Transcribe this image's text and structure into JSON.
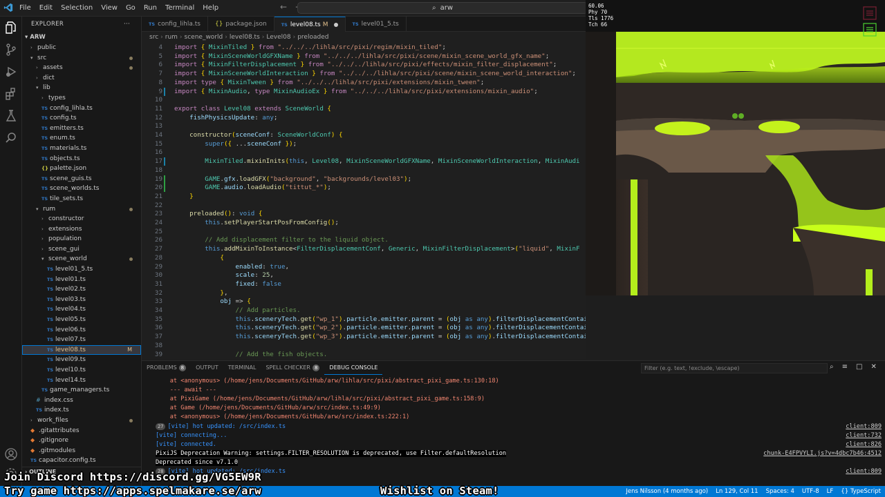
{
  "menu": [
    "File",
    "Edit",
    "Selection",
    "View",
    "Go",
    "Run",
    "Terminal",
    "Help"
  ],
  "command_center": "arw",
  "sidebar": {
    "title": "EXPLORER",
    "root": "ARW",
    "items": [
      {
        "label": "public",
        "type": "folder",
        "indent": 1,
        "open": false
      },
      {
        "label": "src",
        "type": "folder",
        "indent": 1,
        "open": true,
        "dot": true
      },
      {
        "label": "assets",
        "type": "folder",
        "indent": 2,
        "open": false,
        "dot": true
      },
      {
        "label": "dict",
        "type": "folder",
        "indent": 2,
        "open": false
      },
      {
        "label": "lib",
        "type": "folder",
        "indent": 2,
        "open": true
      },
      {
        "label": "types",
        "type": "folder",
        "indent": 3,
        "open": false
      },
      {
        "label": "config_lihla.ts",
        "type": "ts",
        "indent": 3
      },
      {
        "label": "config.ts",
        "type": "ts",
        "indent": 3
      },
      {
        "label": "emitters.ts",
        "type": "ts",
        "indent": 3
      },
      {
        "label": "enum.ts",
        "type": "ts",
        "indent": 3
      },
      {
        "label": "materials.ts",
        "type": "ts",
        "indent": 3
      },
      {
        "label": "objects.ts",
        "type": "ts",
        "indent": 3
      },
      {
        "label": "palette.json",
        "type": "json",
        "indent": 3
      },
      {
        "label": "scene_guis.ts",
        "type": "ts",
        "indent": 3
      },
      {
        "label": "scene_worlds.ts",
        "type": "ts",
        "indent": 3
      },
      {
        "label": "tile_sets.ts",
        "type": "ts",
        "indent": 3
      },
      {
        "label": "rum",
        "type": "folder",
        "indent": 2,
        "open": true,
        "dot": true
      },
      {
        "label": "constructor",
        "type": "folder",
        "indent": 3,
        "open": false
      },
      {
        "label": "extensions",
        "type": "folder",
        "indent": 3,
        "open": false
      },
      {
        "label": "population",
        "type": "folder",
        "indent": 3,
        "open": false
      },
      {
        "label": "scene_gui",
        "type": "folder",
        "indent": 3,
        "open": false
      },
      {
        "label": "scene_world",
        "type": "folder",
        "indent": 3,
        "open": true,
        "dot": true
      },
      {
        "label": "level01_5.ts",
        "type": "ts",
        "indent": 4
      },
      {
        "label": "level01.ts",
        "type": "ts",
        "indent": 4
      },
      {
        "label": "level02.ts",
        "type": "ts",
        "indent": 4
      },
      {
        "label": "level03.ts",
        "type": "ts",
        "indent": 4
      },
      {
        "label": "level04.ts",
        "type": "ts",
        "indent": 4
      },
      {
        "label": "level05.ts",
        "type": "ts",
        "indent": 4
      },
      {
        "label": "level06.ts",
        "type": "ts",
        "indent": 4
      },
      {
        "label": "level07.ts",
        "type": "ts",
        "indent": 4
      },
      {
        "label": "level08.ts",
        "type": "ts",
        "indent": 4,
        "active": true,
        "modified": "M"
      },
      {
        "label": "level09.ts",
        "type": "ts",
        "indent": 4
      },
      {
        "label": "level10.ts",
        "type": "ts",
        "indent": 4
      },
      {
        "label": "level14.ts",
        "type": "ts",
        "indent": 4
      },
      {
        "label": "game_managers.ts",
        "type": "ts",
        "indent": 3
      },
      {
        "label": "index.css",
        "type": "css",
        "indent": 2
      },
      {
        "label": "index.ts",
        "type": "ts",
        "indent": 2
      },
      {
        "label": "work_files",
        "type": "folder",
        "indent": 1,
        "open": false,
        "dot": true
      },
      {
        "label": ".gitattributes",
        "type": "git",
        "indent": 1
      },
      {
        "label": ".gitignore",
        "type": "git",
        "indent": 1
      },
      {
        "label": ".gitmodules",
        "type": "git",
        "indent": 1
      },
      {
        "label": "capacitor.config.ts",
        "type": "ts",
        "indent": 1
      }
    ],
    "outline": "OUTLINE"
  },
  "tabs": [
    {
      "label": "config_lihla.ts",
      "icon": "TS"
    },
    {
      "label": "package.json",
      "icon": "{}"
    },
    {
      "label": "level08.ts",
      "icon": "TS",
      "active": true,
      "mark": "M"
    },
    {
      "label": "level01_5.ts",
      "icon": "TS"
    }
  ],
  "breadcrumb": [
    "src",
    "rum",
    "scene_world",
    "level08.ts",
    "Level08",
    "preloaded"
  ],
  "editor": {
    "lines": [
      {
        "n": "4",
        "t": "import { MixinTiled } from \"../../../lihla/src/pixi/regim/mixin_tiled\";"
      },
      {
        "n": "5",
        "t": "import { MixinSceneWorldGFXName } from \"../../../lihla/src/pixi/scene/mixin_scene_world_gfx_name\";"
      },
      {
        "n": "6",
        "t": "import { MixinFilterDisplacement } from \"../../../lihla/src/pixi/effects/mixin_filter_displacement\";"
      },
      {
        "n": "7",
        "t": "import { MixinSceneWorldInteraction } from \"../../../lihla/src/pixi/scene/mixin_scene_world_interaction\";"
      },
      {
        "n": "8",
        "t": "import type { MixinTween } from \"../../../lihla/src/pixi/extensions/mixin_tween\";"
      },
      {
        "n": "9",
        "t": "import { MixinAudio, type MixinAudioEx } from \"../../../lihla/src/pixi/extensions/mixin_audio\";"
      },
      {
        "n": "10",
        "t": ""
      },
      {
        "n": "11",
        "t": "export class Level08 extends SceneWorld {"
      },
      {
        "n": "12",
        "t": "    fishPhysicsUpdate: any;"
      },
      {
        "n": "13",
        "t": ""
      },
      {
        "n": "14",
        "t": "    constructor(sceneConf: SceneWorldConf) {"
      },
      {
        "n": "15",
        "t": "        super({ ...sceneConf });"
      },
      {
        "n": "16",
        "t": ""
      },
      {
        "n": "17",
        "t": "        MixinTiled.mixinInits(this, Level08, MixinSceneWorldGFXName, MixinSceneWorldInteraction, MixinAudi"
      },
      {
        "n": "18",
        "t": ""
      },
      {
        "n": "19",
        "t": "        GAME.gfx.loadGFX(\"background\", \"backgrounds/level03\");"
      },
      {
        "n": "20",
        "t": "        GAME.audio.loadAudio(\"tittut_*\");"
      },
      {
        "n": "21",
        "t": "    }"
      },
      {
        "n": "22",
        "t": ""
      },
      {
        "n": "23",
        "t": "    preloaded(): void {"
      },
      {
        "n": "24",
        "t": "        this.setPlayerStartPosFromConfig();"
      },
      {
        "n": "25",
        "t": ""
      },
      {
        "n": "26",
        "t": "        // Add displacement filter to the liquid object."
      },
      {
        "n": "27",
        "t": "        this.addMixinToInstance<FilterDisplacementConf, Generic, MixinFilterDisplacement>(\"liquid\", MixinF"
      },
      {
        "n": "28",
        "t": "            {"
      },
      {
        "n": "29",
        "t": "                enabled: true,"
      },
      {
        "n": "30",
        "t": "                scale: 25,"
      },
      {
        "n": "31",
        "t": "                fixed: false"
      },
      {
        "n": "32",
        "t": "            },"
      },
      {
        "n": "33",
        "t": "            obj => {"
      },
      {
        "n": "34",
        "t": "                // Add particles."
      },
      {
        "n": "35",
        "t": "                this.sceneryTech.get(\"wp_1\").particle.emitter.parent = (obj as any).filterDisplacementContainer;"
      },
      {
        "n": "36",
        "t": "                this.sceneryTech.get(\"wp_2\").particle.emitter.parent = (obj as any).filterDisplacementContainer;"
      },
      {
        "n": "37",
        "t": "                this.sceneryTech.get(\"wp_3\").particle.emitter.parent = (obj as any).filterDisplacementContainer;"
      },
      {
        "n": "38",
        "t": ""
      },
      {
        "n": "39",
        "t": "                // Add the fish objects."
      }
    ]
  },
  "game": {
    "stats": [
      "60.06",
      "Phy 70",
      "Tls 1776",
      "Tch 66"
    ]
  },
  "panel": {
    "tabs": [
      {
        "label": "PROBLEMS",
        "badge": "8"
      },
      {
        "label": "OUTPUT"
      },
      {
        "label": "TERMINAL"
      },
      {
        "label": "SPELL CHECKER",
        "badge": "8"
      },
      {
        "label": "DEBUG CONSOLE",
        "active": true
      }
    ],
    "filter_placeholder": "Filter (e.g. text, !exclude, \\escape)",
    "console": [
      {
        "text": "    at <anonymous> (/home/jens/Documents/GitHub/arw/lihla/src/pixi/abstract_pixi_game.ts:130:18)",
        "kind": "err"
      },
      {
        "text": "    --- await ---",
        "kind": "err"
      },
      {
        "text": "    at PixiGame (/home/jens/Documents/GitHub/arw/lihla/src/pixi/abstract_pixi_game.ts:158:9)",
        "kind": "err"
      },
      {
        "text": "    at Game (/home/jens/Documents/GitHub/arw/src/index.ts:49:9)",
        "kind": "err"
      },
      {
        "text": "    at <anonymous> (/home/jens/Documents/GitHub/arw/src/index.ts:222:1)",
        "kind": "err"
      },
      {
        "text": "[vite] hot updated: /src/index.ts",
        "kind": "info",
        "count": "27",
        "source": "client:809"
      },
      {
        "text": "[vite] connecting...",
        "kind": "info",
        "source": "client:732"
      },
      {
        "text": "[vite] connected.",
        "kind": "info",
        "source": "client:826"
      },
      {
        "text": "PixiJS Deprecation Warning: settings.FILTER_RESOLUTION is deprecated, use Filter.defaultResolution",
        "kind": "warn",
        "source": "chunk-E4FPVYLI.js?v=4dbc7b46:4512"
      },
      {
        "text": "Deprecated since v7.1.0",
        "kind": "warn"
      },
      {
        "text": "[vite] hot updated: /src/index.ts",
        "kind": "info",
        "count": "28",
        "source": "client:809"
      }
    ]
  },
  "statusbar": {
    "items": [
      "Jens Nilsson (4 months ago)",
      "Ln 129, Col 11",
      "Spaces: 4",
      "UTF-8",
      "LF",
      "{} TypeScript"
    ]
  },
  "overlay": {
    "discord": "Join Discord https://discord.gg/VG5EW9R",
    "game": "Try game https://apps.spelmakare.se/arw",
    "steam": "Wishlist on Steam!"
  }
}
